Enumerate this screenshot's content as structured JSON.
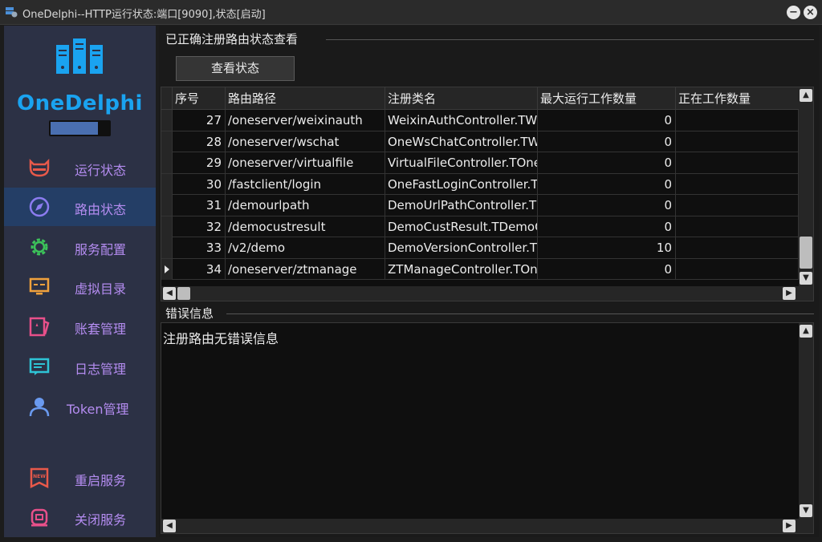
{
  "window": {
    "title": "OneDelphi--HTTP运行状态:端口[9090],状态[启动]",
    "minimize_label": "−",
    "close_label": "×"
  },
  "sidebar": {
    "logo_text": "OneDelphi",
    "items": [
      {
        "label": "运行状态",
        "icon": "gauge-icon",
        "color": "#e8594a"
      },
      {
        "label": "路由状态",
        "icon": "compass-icon",
        "color": "#8c7cf0",
        "active": true
      },
      {
        "label": "服务配置",
        "icon": "gear-icon",
        "color": "#3cc45a"
      },
      {
        "label": "虚拟目录",
        "icon": "monitor-icon",
        "color": "#f0a13c"
      },
      {
        "label": "账套管理",
        "icon": "card-icon",
        "color": "#e8508a"
      },
      {
        "label": "日志管理",
        "icon": "message-icon",
        "color": "#2ec4d6"
      },
      {
        "label": "Token管理",
        "icon": "user-icon",
        "color": "#6a9af0"
      },
      {
        "label": "重启服务",
        "icon": "new-badge-icon",
        "color": "#e8594a"
      },
      {
        "label": "关闭服务",
        "icon": "stop-icon",
        "color": "#e8508a"
      }
    ]
  },
  "main": {
    "section_title": "已正确注册路由状态查看",
    "view_button": "查看状态",
    "grid": {
      "columns": [
        "序号",
        "路由路径",
        "注册类名",
        "最大运行工作数量",
        "正在工作数量"
      ],
      "rows": [
        {
          "id": "27",
          "path": "/oneserver/weixinauth",
          "cls": "WeixinAuthController.TWeixinAuthController",
          "max": "0",
          "working": ""
        },
        {
          "id": "28",
          "path": "/oneserver/wschat",
          "cls": "OneWsChatController.TWsChatController",
          "max": "0",
          "working": ""
        },
        {
          "id": "29",
          "path": "/oneserver/virtualfile",
          "cls": "VirtualFileController.TOneVirtualFileController",
          "max": "0",
          "working": ""
        },
        {
          "id": "30",
          "path": "/fastclient/login",
          "cls": "OneFastLoginController.TFastLoginController",
          "max": "0",
          "working": ""
        },
        {
          "id": "31",
          "path": "/demourlpath",
          "cls": "DemoUrlPathController.TDemoUrlPathController",
          "max": "0",
          "working": ""
        },
        {
          "id": "32",
          "path": "/democustresult",
          "cls": "DemoCustResult.TDemoCustResultController",
          "max": "0",
          "working": ""
        },
        {
          "id": "33",
          "path": "/v2/demo",
          "cls": "DemoVersionController.TDemoVersionController",
          "max": "10",
          "working": ""
        },
        {
          "id": "34",
          "path": "/oneserver/ztmanage",
          "cls": "ZTManageController.TOneZTManageController",
          "max": "0",
          "working": "",
          "current": true
        }
      ]
    },
    "error_title": "错误信息",
    "error_text": "注册路由无错误信息"
  }
}
